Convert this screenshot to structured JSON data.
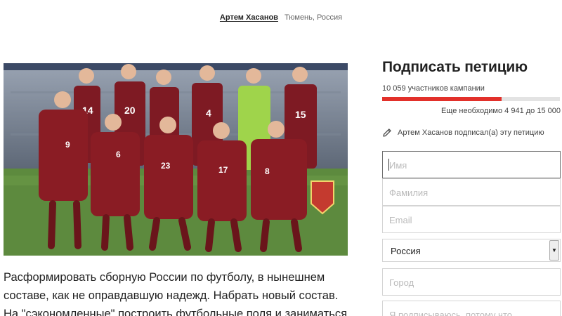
{
  "header": {
    "author_name": "Артем Хасанов",
    "location": "Тюмень, Россия"
  },
  "petition": {
    "description": "Расформировать сборную России по футболу, в нынешнем составе, как не оправдавшую надежд. Набрать новый состав. На \"сэкономленные\" построить футбольные поля и заниматься"
  },
  "sign_panel": {
    "title": "Подписать петицию",
    "participants": "10 059 участников кампании",
    "progress_fraction": 0.671,
    "remaining": "Еще необходимо 4 941 до 15 000",
    "signed_note": "Артем Хасанов подписал(а) эту петицию",
    "fields": {
      "first_name_placeholder": "Имя",
      "last_name_placeholder": "Фамилия",
      "email_placeholder": "Email",
      "country_value": "Россия",
      "city_placeholder": "Город",
      "reason_placeholder": "Я подписываюсь, потому что"
    }
  },
  "colors": {
    "progress_fill": "#e2302a",
    "jersey": "#8a1c24"
  },
  "icons": {
    "signed_note": "pencil-icon",
    "country_select": "chevron-down-icon"
  }
}
